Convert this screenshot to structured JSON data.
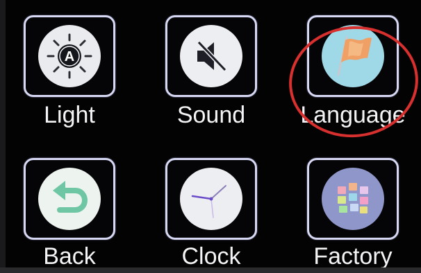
{
  "menu": {
    "items": [
      {
        "label": "Light",
        "icon": "brightness-icon"
      },
      {
        "label": "Sound",
        "icon": "mute-speaker-icon"
      },
      {
        "label": "Language",
        "icon": "flag-icon"
      },
      {
        "label": "Back",
        "icon": "back-arrow-icon"
      },
      {
        "label": "Clock",
        "icon": "clock-icon"
      },
      {
        "label": "Factory",
        "icon": "app-grid-icon"
      }
    ],
    "selected": "Language"
  },
  "colors": {
    "background": "#030304",
    "tile_border": "#d7d9f4",
    "label_text": "#f4f4f6",
    "highlight_ring": "#d8302e"
  }
}
